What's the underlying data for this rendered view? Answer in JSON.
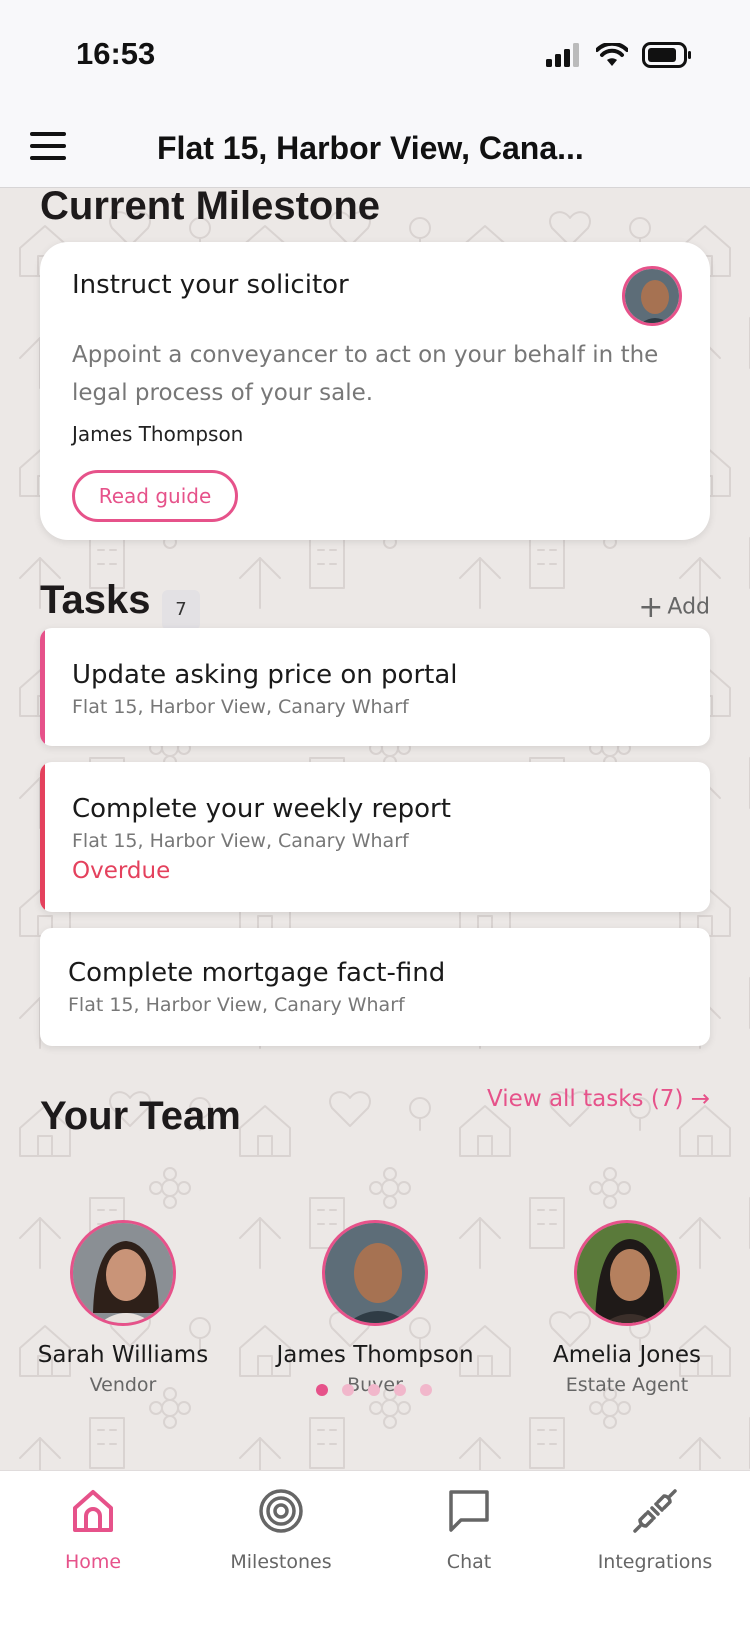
{
  "status_bar": {
    "time": "16:53"
  },
  "header": {
    "title": "Flat 15, Harbor View, Cana..."
  },
  "milestone": {
    "heading": "Current Milestone",
    "title": "Instruct your solicitor",
    "description": "Appoint a conveyancer to act on your behalf in the legal process of your sale.",
    "person": "James Thompson",
    "button_label": "Read guide"
  },
  "tasks": {
    "heading": "Tasks",
    "count": "7",
    "add_label": "Add",
    "items": [
      {
        "title": "Update asking price on portal",
        "subtitle": "Flat 15, Harbor View, Canary Wharf",
        "status": ""
      },
      {
        "title": "Complete your weekly report",
        "subtitle": "Flat 15, Harbor View, Canary Wharf",
        "status": "Overdue"
      },
      {
        "title": "Complete mortgage fact-find",
        "subtitle": "Flat 15, Harbor View, Canary Wharf",
        "status": ""
      }
    ],
    "view_all_label": "View all tasks (7) →"
  },
  "team": {
    "heading": "Your Team",
    "members": [
      {
        "name": "Sarah Williams",
        "role": "Vendor"
      },
      {
        "name": "James Thompson",
        "role": "Buyer"
      },
      {
        "name": "Amelia Jones",
        "role": "Estate Agent"
      }
    ],
    "pages": 5,
    "active_page": 1
  },
  "tab_bar": {
    "items": [
      {
        "label": "Home",
        "icon": "home-icon",
        "active": true
      },
      {
        "label": "Milestones",
        "icon": "target-icon",
        "active": false
      },
      {
        "label": "Chat",
        "icon": "chat-icon",
        "active": false
      },
      {
        "label": "Integrations",
        "icon": "plug-icon",
        "active": false
      }
    ]
  },
  "colors": {
    "accent": "#e6528a",
    "overdue": "#e4415d",
    "background": "#ece8e6"
  }
}
